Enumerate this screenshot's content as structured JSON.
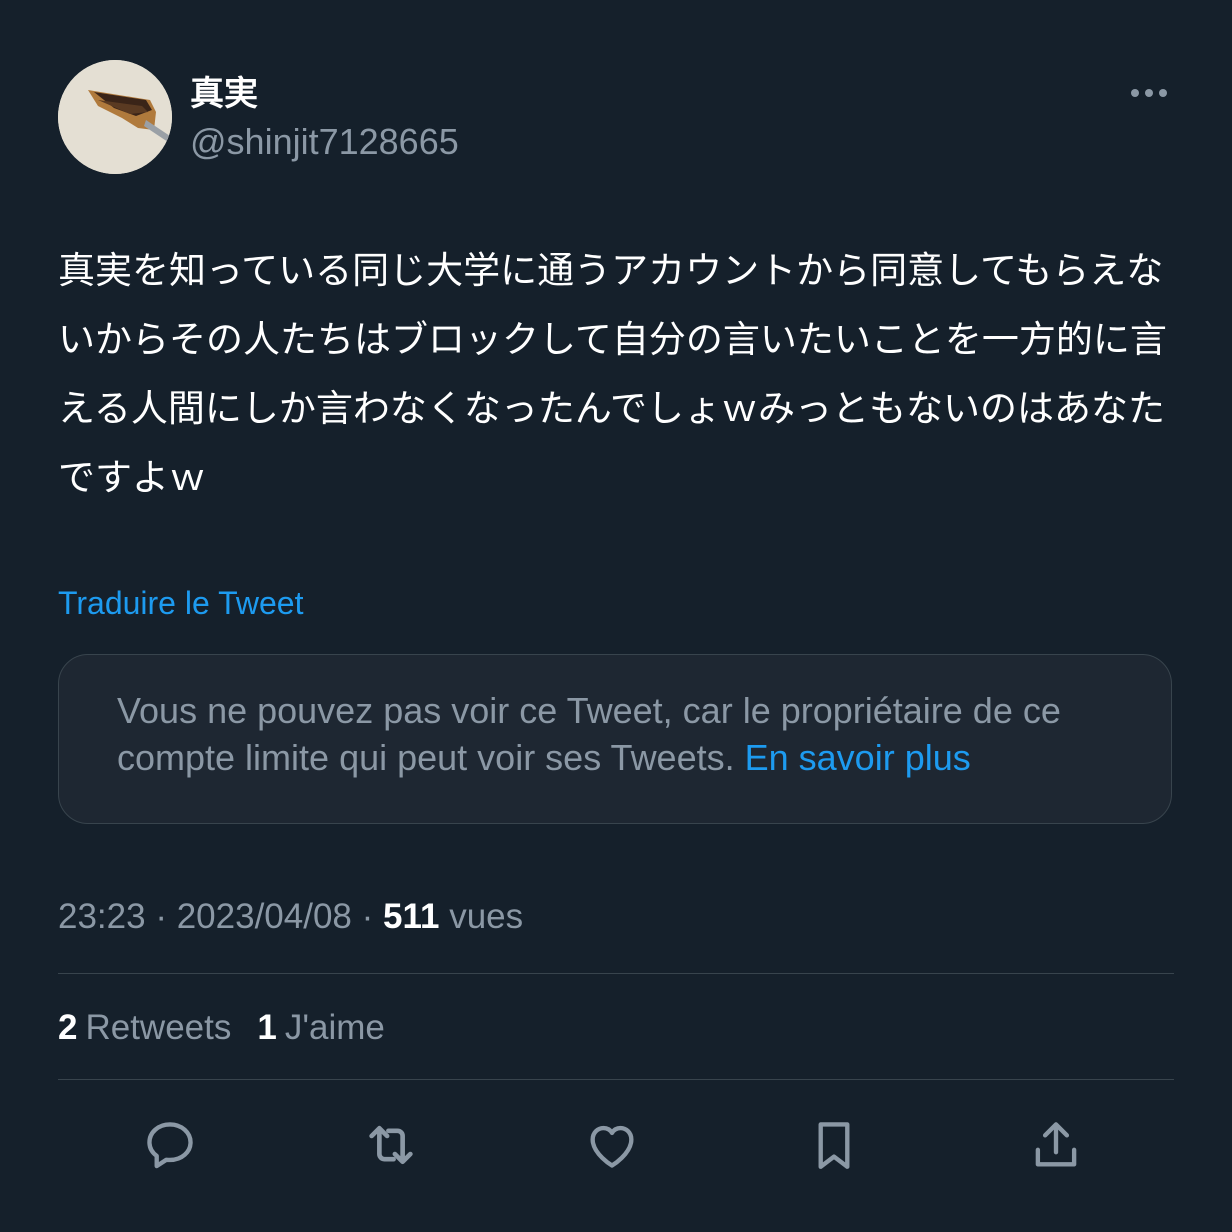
{
  "tweet": {
    "display_name": "真実",
    "handle": "@shinjit7128665",
    "text": "真実を知っている同じ大学に通うアカウントから同意してもらえないからその人たちはブロックして自分の言いたいことを一方的に言える人間にしか言わなくなったんでしょｗみっともないのはあなたですよｗ",
    "translate_label": "Traduire le Tweet",
    "quoted_unavailable": {
      "message": "Vous ne pouvez pas voir ce Tweet, car le propriétaire de ce compte limite qui peut voir ses Tweets.",
      "learn_more_label": "En savoir plus"
    },
    "time": "23:23",
    "date": "2023/04/08",
    "separator": "·",
    "views_count": "511",
    "views_label": "vues",
    "retweets_count": "2",
    "retweets_label": "Retweets",
    "likes_count": "1",
    "likes_label": "J'aime"
  },
  "actions": [
    {
      "name": "reply",
      "icon": "reply-icon"
    },
    {
      "name": "retweet",
      "icon": "retweet-icon"
    },
    {
      "name": "like",
      "icon": "heart-icon"
    },
    {
      "name": "bookmark",
      "icon": "bookmark-icon"
    },
    {
      "name": "share",
      "icon": "share-icon"
    }
  ],
  "colors": {
    "background": "#15202b",
    "primary_text": "#ffffff",
    "secondary_text": "#8b98a5",
    "accent": "#1d9bf0",
    "border": "#38444d"
  }
}
